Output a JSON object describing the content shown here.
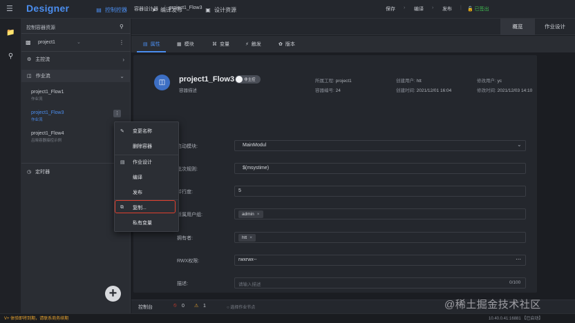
{
  "app": {
    "brand": "Designer"
  },
  "topnav": [
    {
      "label": "控制控器",
      "icon": "dashboard-icon",
      "active": true
    },
    {
      "label": "编译发布",
      "icon": "send-icon",
      "active": false
    },
    {
      "label": "设计资源",
      "icon": "car-icon",
      "active": false
    }
  ],
  "leftpanel": {
    "title": "控制容器资源",
    "project_select": "project1",
    "sections": {
      "main": "主控流",
      "flow": "作业流",
      "timer": "定时器"
    },
    "flows": [
      {
        "name": "project1_Flow1",
        "sub": "作业流"
      },
      {
        "name": "project1_Flow3",
        "sub": "作业流"
      },
      {
        "name": "project1_Flow4",
        "sub": "吕晓容器接控示例"
      }
    ]
  },
  "context_menu": {
    "items": [
      {
        "label": "变更名称",
        "icon": "edit-icon"
      },
      {
        "label": "删除容器",
        "icon": ""
      },
      {
        "label": "作业设计",
        "icon": "design-icon"
      },
      {
        "label": "编译",
        "icon": ""
      },
      {
        "label": "发布",
        "icon": ""
      },
      {
        "label": "复制...",
        "icon": "copy-icon"
      },
      {
        "label": "私有变量",
        "icon": ""
      }
    ]
  },
  "breadcrumb": {
    "root": "容器设计器",
    "sep": "|",
    "current": "project1_Flow3"
  },
  "header_actions": {
    "save": "保存",
    "compile": "编译",
    "publish": "发布",
    "checkout": "已签出",
    "overview": "概览",
    "job_design": "作业设计"
  },
  "tabs": [
    {
      "label": "属性",
      "icon": "properties-icon"
    },
    {
      "label": "模块",
      "icon": "module-icon"
    },
    {
      "label": "变量",
      "icon": "variable-icon"
    },
    {
      "label": "触发",
      "icon": "trigger-icon"
    },
    {
      "label": "版本",
      "icon": "version-icon"
    }
  ],
  "flow": {
    "title": "project1_Flow3",
    "desc": "容器描述",
    "switch_label": "非主控",
    "meta": {
      "project_label": "所属工程:",
      "project": "project1",
      "number_label": "容器编号:",
      "number": "24",
      "creator_label": "创建用户:",
      "creator": "htt",
      "created_label": "创建时间:",
      "created": "2021/12/01 16:04",
      "modifier_label": "修改用户:",
      "modifier": "yc",
      "modified_label": "修改时间:",
      "modified": "2021/12/03 14:10"
    }
  },
  "form": {
    "start_module_label": "启动模块:",
    "start_module": "MainModul",
    "batch_rule_label": "批次规则:",
    "batch_rule": "$(msystime)",
    "parallel_label": "并行度:",
    "parallel": "5",
    "group_label": "所属用户组:",
    "group_chip": "admin",
    "owner_label": "拥有者:",
    "owner_chip": "htt",
    "rwx_label": "RWX权限:",
    "rwx": "rwxrwx--",
    "desc_label": "描述:",
    "desc_placeholder": "请输入描述",
    "desc_count": "0/100"
  },
  "console": {
    "label": "控制台",
    "errors": "0",
    "warnings": "1",
    "hint": "选择作业节点"
  },
  "statusbar": {
    "warn": "V+ 体验即将到期，请联系商务续期",
    "ip": "10.40.0.41:16881 【已启动】"
  },
  "watermark": "@稀土掘金技术社区",
  "colors": {
    "accent": "#4b8ef0",
    "danger": "#e0402e",
    "warning": "#e8a32e",
    "success": "#3fb950"
  }
}
